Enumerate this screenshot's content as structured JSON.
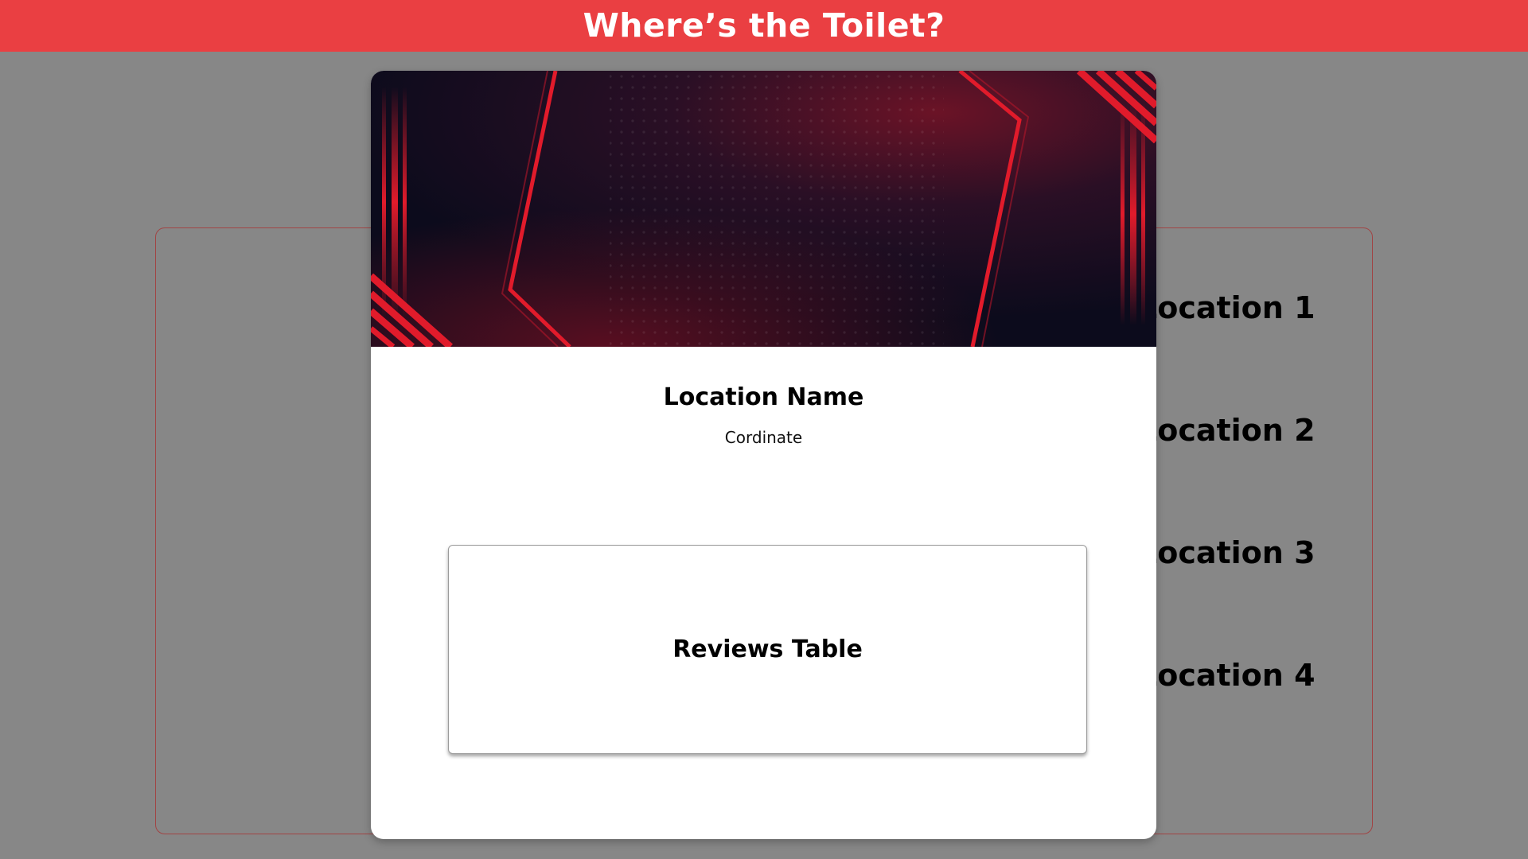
{
  "header": {
    "title": "Where’s the Toilet?",
    "background_color": "#ea3f42"
  },
  "locations": [
    {
      "label": "Location 1"
    },
    {
      "label": "Location 2"
    },
    {
      "label": "Location 3"
    },
    {
      "label": "Location 4"
    }
  ],
  "modal": {
    "location_name": "Location Name",
    "coordinate": "Cordinate",
    "reviews_table_label": "Reviews Table",
    "banner_colors": {
      "dark": "#0c0b1c",
      "accent": "#e11b2b"
    }
  }
}
